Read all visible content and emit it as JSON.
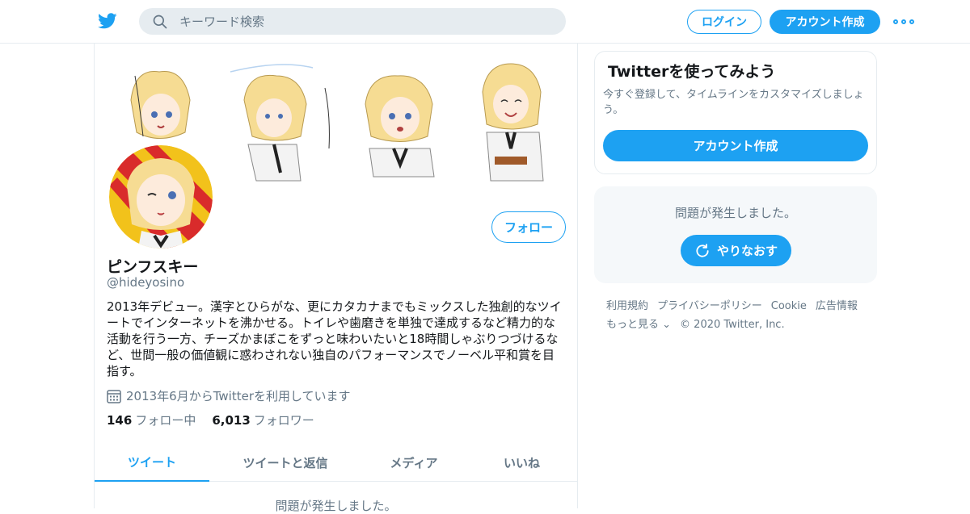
{
  "header": {
    "search_placeholder": "キーワード検索",
    "login_label": "ログイン",
    "signup_label": "アカウント作成"
  },
  "profile": {
    "name": "ピンフスキー",
    "handle": "@hideyosino",
    "bio": "2013年デビュー。漢字とひらがな、更にカタカナまでもミックスした独創的なツイートでインターネットを沸かせる。トイレや歯磨きを単独で達成するなど精力的な活動を行う一方、チーズかまぼこをずっと味わいたいと18時間しゃぶりつづけるなど、世間一般の価値観に惑わされない独自のパフォーマンスでノーベル平和賞を目指す。",
    "joined": "2013年6月からTwitterを利用しています",
    "follow_label": "フォロー",
    "following_count": "146",
    "following_label": "フォロー中",
    "followers_count": "6,013",
    "followers_label": "フォロワー"
  },
  "tabs": [
    {
      "label": "ツイート",
      "active": true
    },
    {
      "label": "ツイートと返信",
      "active": false
    },
    {
      "label": "メディア",
      "active": false
    },
    {
      "label": "いいね",
      "active": false
    }
  ],
  "feed": {
    "error_text": "問題が発生しました。"
  },
  "sidebar": {
    "signup_title": "Twitterを使ってみよう",
    "signup_desc": "今すぐ登録して、タイムラインをカスタマイズしましょう。",
    "signup_button": "アカウント作成",
    "error_text": "問題が発生しました。",
    "retry_label": "やりなおす"
  },
  "footer": {
    "links": [
      "利用規約",
      "プライバシーポリシー",
      "Cookie",
      "広告情報",
      "もっと見る"
    ],
    "copyright": "© 2020 Twitter, Inc."
  },
  "colors": {
    "accent": "#1da1f2",
    "muted": "#657786",
    "border": "#e6ecf0"
  }
}
